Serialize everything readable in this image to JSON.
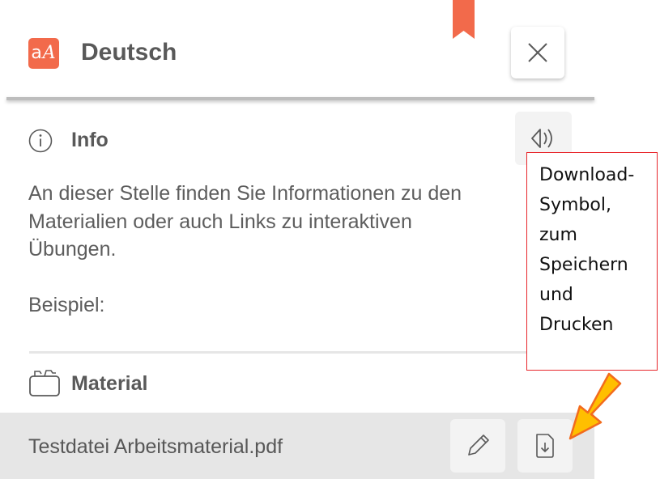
{
  "header": {
    "app_badge": "a ",
    "app_badge_a": "a",
    "app_badge_A": "A",
    "title": "Deutsch",
    "bookmark_icon": "bookmark-icon",
    "close_icon": "close-icon"
  },
  "info": {
    "icon": "info-icon",
    "title": "Info",
    "audio_icon": "audio-icon",
    "lines": [
      "An dieser Stelle finden Sie Informationen zu den",
      "Materialien oder auch Links zu interaktiven",
      "Übungen.",
      "Beispiel:"
    ]
  },
  "material": {
    "icon": "folder-icon",
    "title": "Material",
    "file_name": "Testdatei Arbeitsmaterial.pdf",
    "edit_icon": "pencil-icon",
    "download_icon": "download-icon"
  },
  "callout": {
    "lines": [
      "Download-",
      "Symbol,",
      "zum",
      "Speichern",
      "und",
      "Drucken"
    ]
  },
  "colors": {
    "accent": "#f26a4b",
    "callout_border": "#e8262b",
    "arrow_fill": "#ffbf00",
    "arrow_stroke": "#f26b1d"
  }
}
